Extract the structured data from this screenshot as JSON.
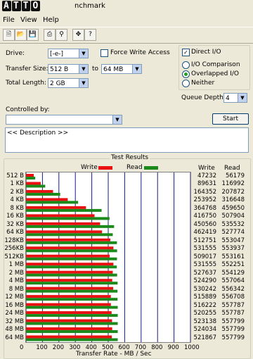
{
  "window": {
    "title": "nchmark",
    "logo_text": "ATTO"
  },
  "menu": [
    "File",
    "View",
    "Help"
  ],
  "toolbar": {
    "icons": [
      "new-file-icon",
      "open-folder-icon",
      "save-icon",
      "print-icon",
      "print-preview-icon",
      "move-icon",
      "help-pointer-icon"
    ]
  },
  "form": {
    "drive_label": "Drive:",
    "drive_value": "[-e-]",
    "force_write_label": "Force Write Access",
    "force_write_checked": false,
    "direct_io_label": "Direct I/O",
    "direct_io_checked": true,
    "transfer_size_label": "Transfer Size:",
    "transfer_from": "512 B",
    "to_label": "to",
    "transfer_to": "64 MB",
    "total_length_label": "Total Length:",
    "total_length": "2 GB",
    "io_comparison_label": "I/O Comparison",
    "overlapped_io_label": "Overlapped I/O",
    "neither_label": "Neither",
    "queue_depth_label": "Queue Depth:",
    "queue_depth": "4",
    "controlled_by_label": "Controlled by:",
    "controlled_by": "",
    "start_label": "Start",
    "description": "<< Description >>"
  },
  "results": {
    "title": "Test Results",
    "write_label": "Write",
    "read_label": "Read",
    "col_write": "Write",
    "col_read": "Read",
    "write_color": "#e81010",
    "read_color": "#1a8a1a",
    "xlabel": "Transfer Rate - MB / Sec"
  },
  "chart_data": {
    "type": "bar",
    "orientation": "horizontal",
    "xlabel": "Transfer Rate - MB / Sec",
    "xlim": [
      0,
      1000
    ],
    "xticks": [
      "0",
      "100",
      "200",
      "300",
      "400",
      "500",
      "600",
      "700",
      "800",
      "900",
      "1000"
    ],
    "categories": [
      "512 B",
      "1 KB",
      "2 KB",
      "4 KB",
      "8 KB",
      "16 KB",
      "32 KB",
      "64 KB",
      "128KB",
      "256KB",
      "512KB",
      "1 MB",
      "2 MB",
      "4 MB",
      "8 MB",
      "12 MB",
      "16 MB",
      "24 MB",
      "32 MB",
      "48 MB",
      "64 MB"
    ],
    "series": [
      {
        "name": "Write",
        "values": [
          47232,
          89631,
          164352,
          253952,
          364768,
          416750,
          450560,
          462419,
          512751,
          531555,
          509017,
          531555,
          527637,
          524290,
          530242,
          515889,
          516222,
          520255,
          523138,
          524034,
          521867
        ]
      },
      {
        "name": "Read",
        "values": [
          56179,
          116992,
          207872,
          316648,
          459650,
          507904,
          535532,
          527774,
          553047,
          553937,
          553161,
          552251,
          554129,
          557064,
          556342,
          556708,
          557787,
          557787,
          557799,
          557799,
          557799
        ]
      }
    ],
    "grid": true
  }
}
